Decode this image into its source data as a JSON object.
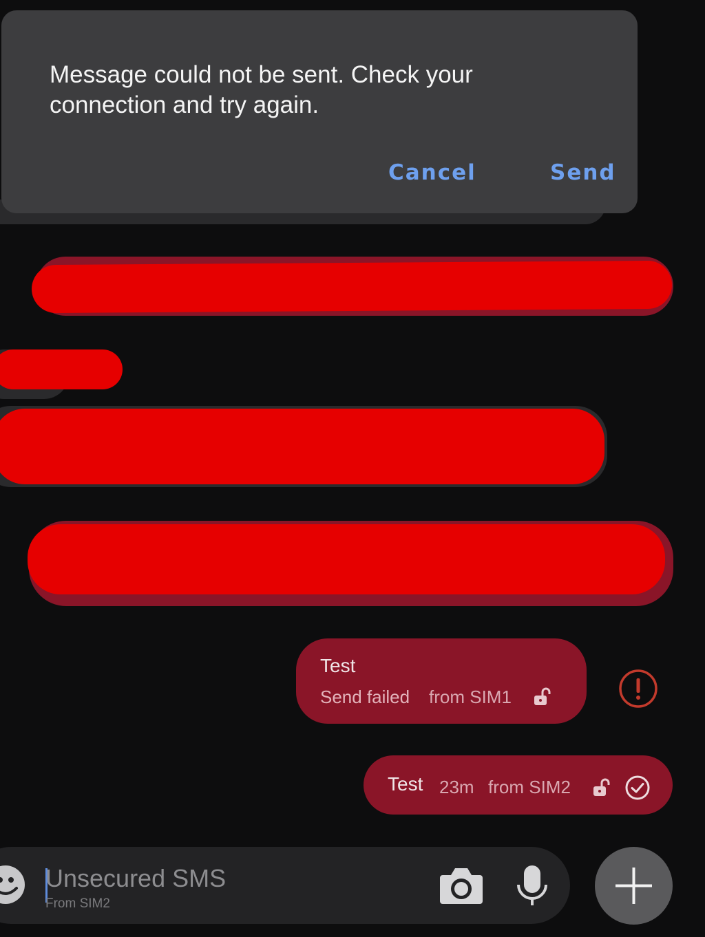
{
  "dialog": {
    "message": "Message could not be sent. Check your connection and try again.",
    "cancel_label": "Cancel",
    "send_label": "Send"
  },
  "messages": [
    {
      "text": "Test",
      "status": "Send failed",
      "sim": "from SIM1",
      "status_icon": "error-icon"
    },
    {
      "text": "Test",
      "time": "23m",
      "sim": "from SIM2",
      "status_icon": "check-circle-icon"
    }
  ],
  "composer": {
    "placeholder": "Unsecured SMS",
    "sim_label": "From SIM2"
  },
  "colors": {
    "sent_bubble": "#8a1528",
    "dialog_bg": "#3d3d3f",
    "accent": "#6ea0ee",
    "error": "#c23a2c",
    "redaction": "#e60000"
  }
}
